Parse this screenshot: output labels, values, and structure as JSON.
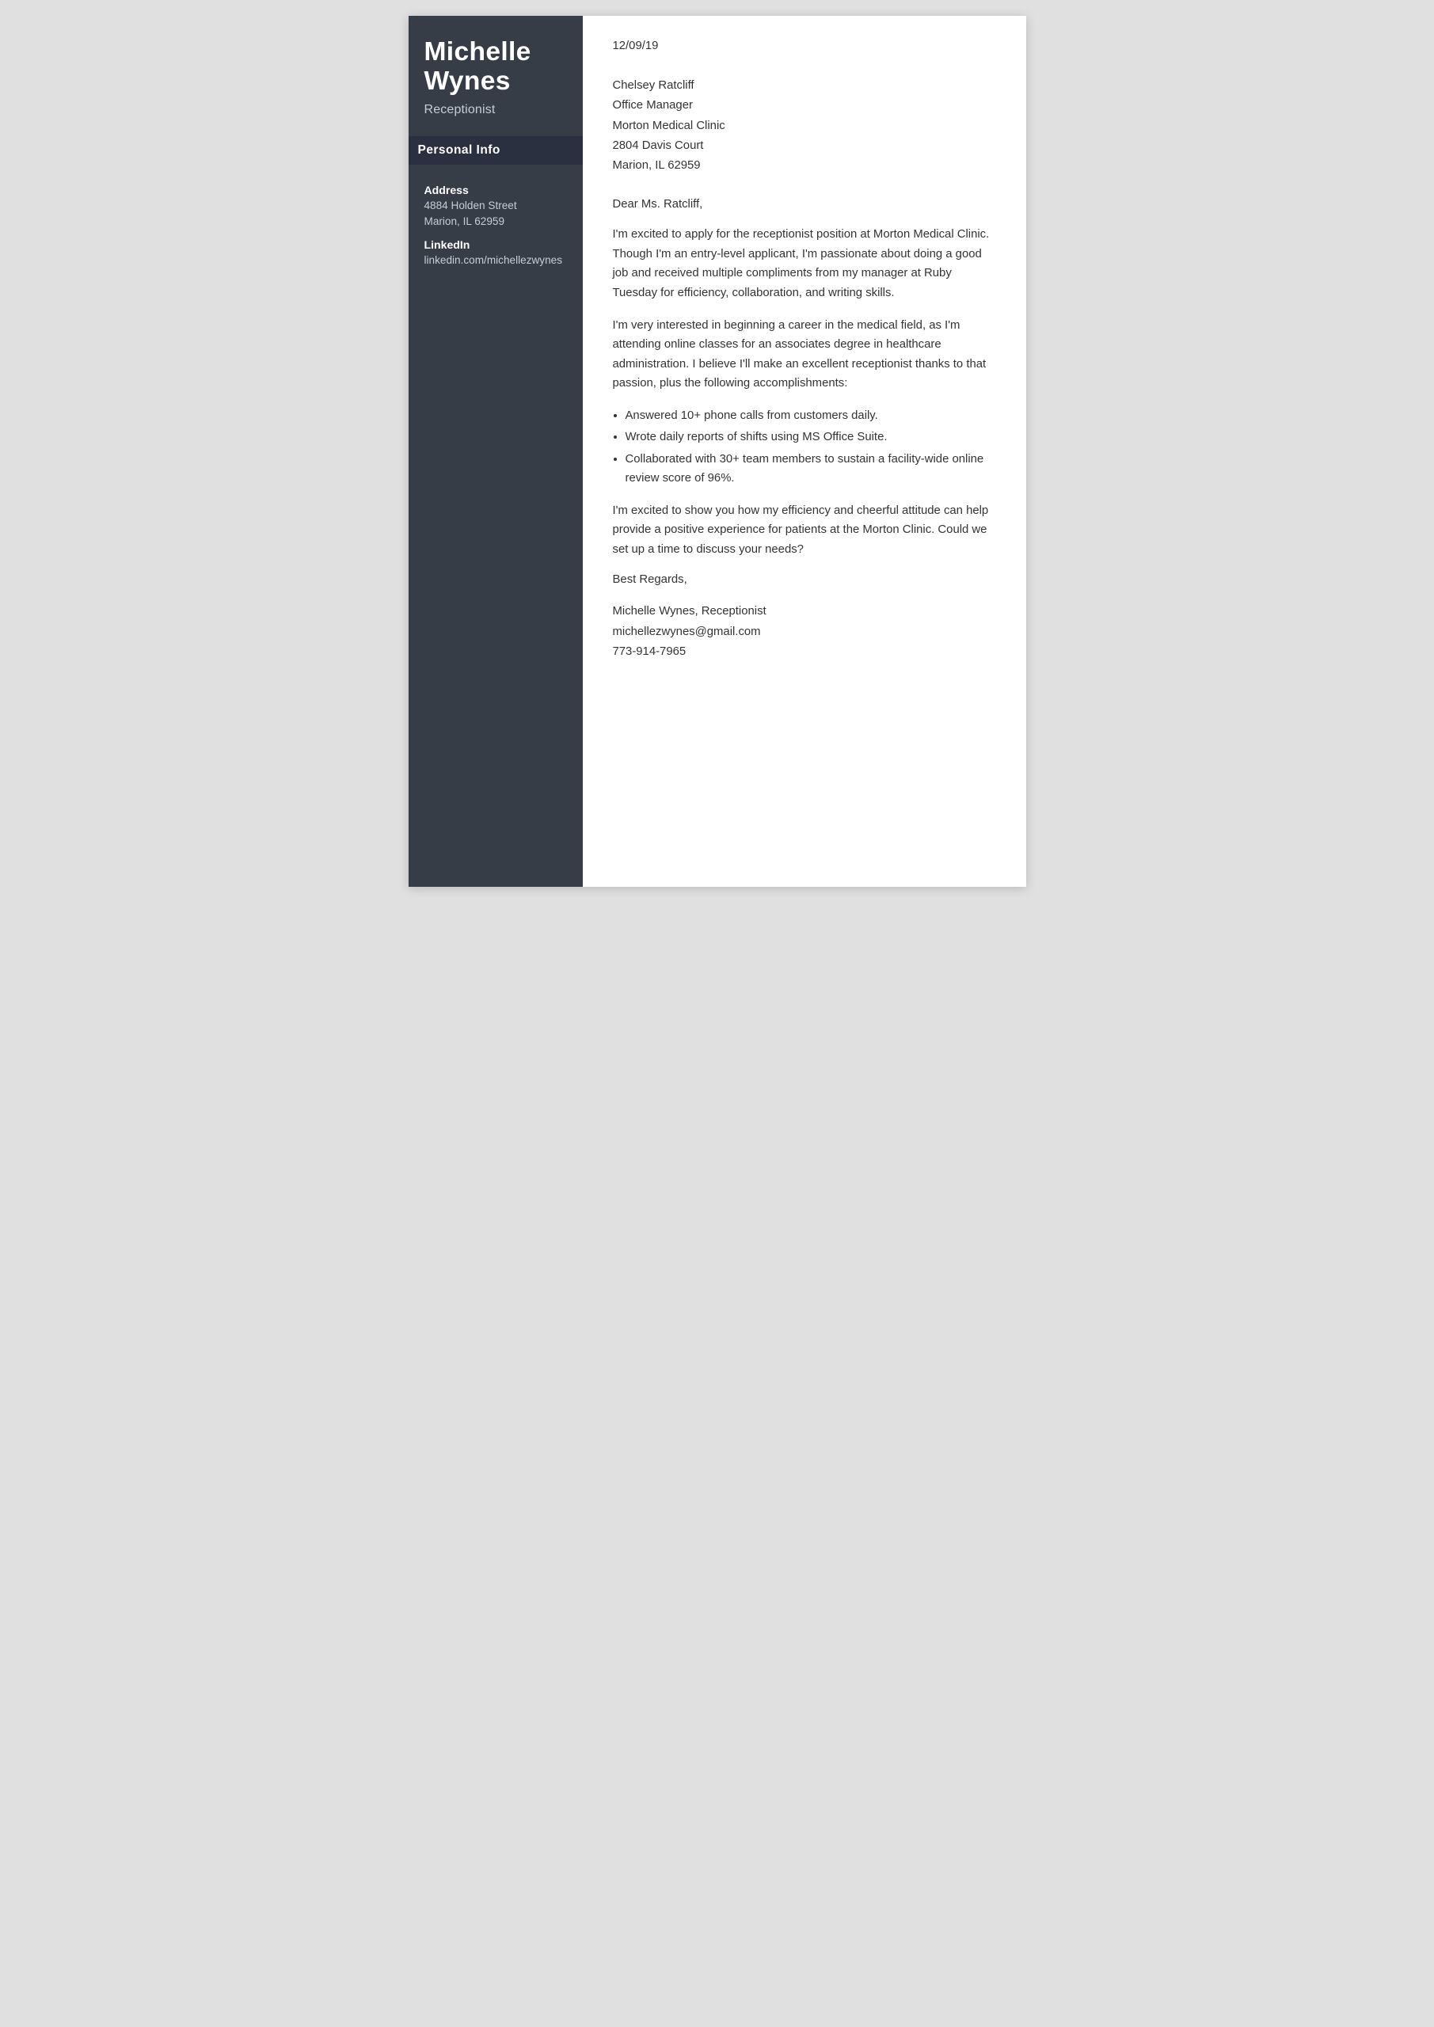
{
  "sidebar": {
    "name_line1": "Michelle",
    "name_line2": "Wynes",
    "title": "Receptionist",
    "personal_info_header": "Personal Info",
    "address_label": "Address",
    "address_line1": "4884 Holden Street",
    "address_line2": "Marion, IL 62959",
    "linkedin_label": "LinkedIn",
    "linkedin_value": "linkedin.com/michellezwynes"
  },
  "letter": {
    "date": "12/09/19",
    "recipient_name": "Chelsey Ratcliff",
    "recipient_title": "Office Manager",
    "recipient_company": "Morton Medical Clinic",
    "recipient_address1": "2804 Davis Court",
    "recipient_address2": "Marion, IL 62959",
    "salutation": "Dear Ms. Ratcliff,",
    "paragraph1": "I'm excited to apply for the receptionist position at Morton Medical Clinic. Though I'm an entry-level applicant, I'm passionate about doing a good job and received multiple compliments from my manager at Ruby Tuesday for efficiency, collaboration, and writing skills.",
    "paragraph2": "I'm very interested in beginning a career in the medical field, as I'm attending online classes for an associates degree in healthcare administration. I believe I'll make an excellent receptionist thanks to that passion, plus the following accomplishments:",
    "bullet1": "Answered 10+ phone calls from customers daily.",
    "bullet2": "Wrote daily reports of shifts using MS Office Suite.",
    "bullet3": "Collaborated with 30+ team members to sustain a facility-wide online review score of 96%.",
    "paragraph3": "I'm excited to show you how my efficiency and cheerful attitude can help provide a positive experience for patients at the Morton Clinic. Could we set up a time to discuss your needs?",
    "closing": "Best Regards,",
    "sig_name": "Michelle Wynes, Receptionist",
    "sig_email": "michellezwynes@gmail.com",
    "sig_phone": "773-914-7965"
  }
}
